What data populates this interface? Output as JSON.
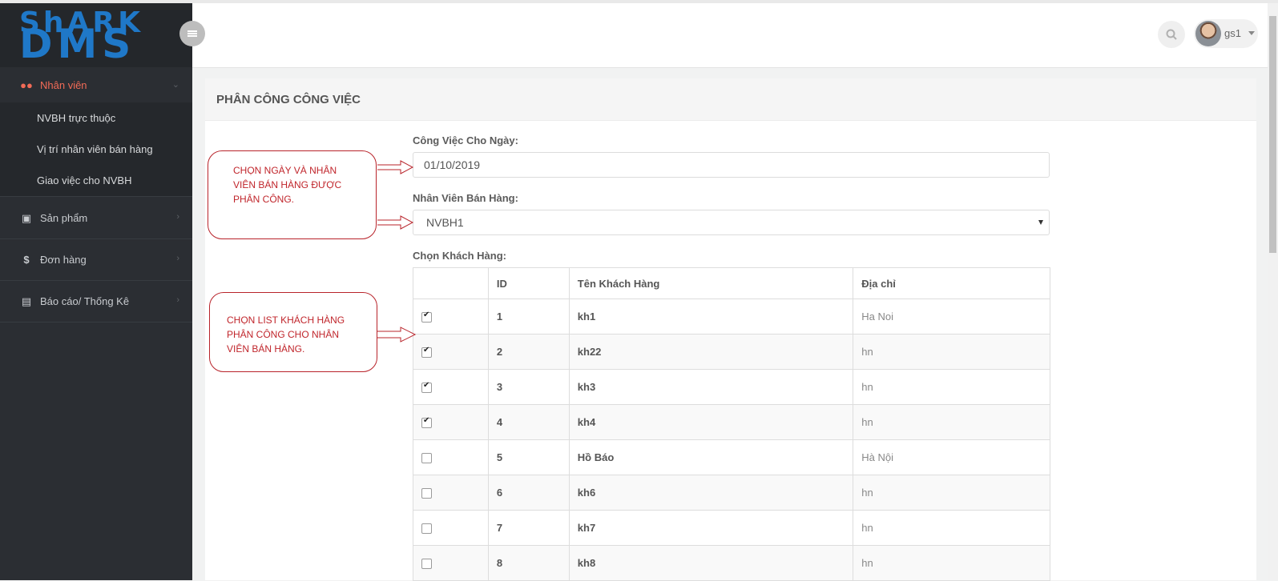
{
  "logo": {
    "line1": "ShARK",
    "line2": "DMS"
  },
  "sidebar": {
    "items": [
      {
        "label": "Nhân viên",
        "icon": "users-icon",
        "active": true,
        "children": [
          "NVBH trực thuộc",
          "Vị trí nhân viên bán hàng",
          "Giao việc cho NVBH"
        ]
      },
      {
        "label": "Sản phẩm",
        "icon": "gift-icon"
      },
      {
        "label": "Đơn hàng",
        "icon": "dollar-icon"
      },
      {
        "label": "Báo cáo/ Thống Kê",
        "icon": "report-icon"
      }
    ]
  },
  "header": {
    "user_name": "gs1"
  },
  "panel": {
    "title": "PHÂN CÔNG CÔNG VIỆC",
    "date_label": "Công Việc Cho Ngày:",
    "date_value": "01/10/2019",
    "staff_label": "Nhân Viên Bán Hàng:",
    "staff_value": "NVBH1",
    "customer_label": "Chọn Khách Hàng:"
  },
  "table": {
    "headers": [
      "",
      "ID",
      "Tên Khách Hàng",
      "Địa chỉ"
    ],
    "rows": [
      {
        "checked": true,
        "id": "1",
        "name": "kh1",
        "address": "Ha Noi"
      },
      {
        "checked": true,
        "id": "2",
        "name": "kh22",
        "address": "hn"
      },
      {
        "checked": true,
        "id": "3",
        "name": "kh3",
        "address": "hn"
      },
      {
        "checked": true,
        "id": "4",
        "name": "kh4",
        "address": "hn"
      },
      {
        "checked": false,
        "id": "5",
        "name": "Hồ Báo",
        "address": "Hà Nội"
      },
      {
        "checked": false,
        "id": "6",
        "name": "kh6",
        "address": "hn"
      },
      {
        "checked": false,
        "id": "7",
        "name": "kh7",
        "address": "hn"
      },
      {
        "checked": false,
        "id": "8",
        "name": "kh8",
        "address": "hn"
      }
    ]
  },
  "annotations": {
    "callout1": [
      "CHỌN NGÀY VÀ NHÂN",
      "VIÊN BÁN HÀNG ĐƯỢC",
      "PHÂN CÔNG."
    ],
    "callout2": [
      "CHỌN LIST KHÁCH HÀNG",
      "PHÂN CÔNG CHO NHÂN",
      "VIÊN BÁN HÀNG."
    ]
  },
  "colors": {
    "accent": "#f26b57",
    "sidebar": "#2b2e33",
    "logo": "#1f78c8",
    "annotation": "#c0252b"
  }
}
